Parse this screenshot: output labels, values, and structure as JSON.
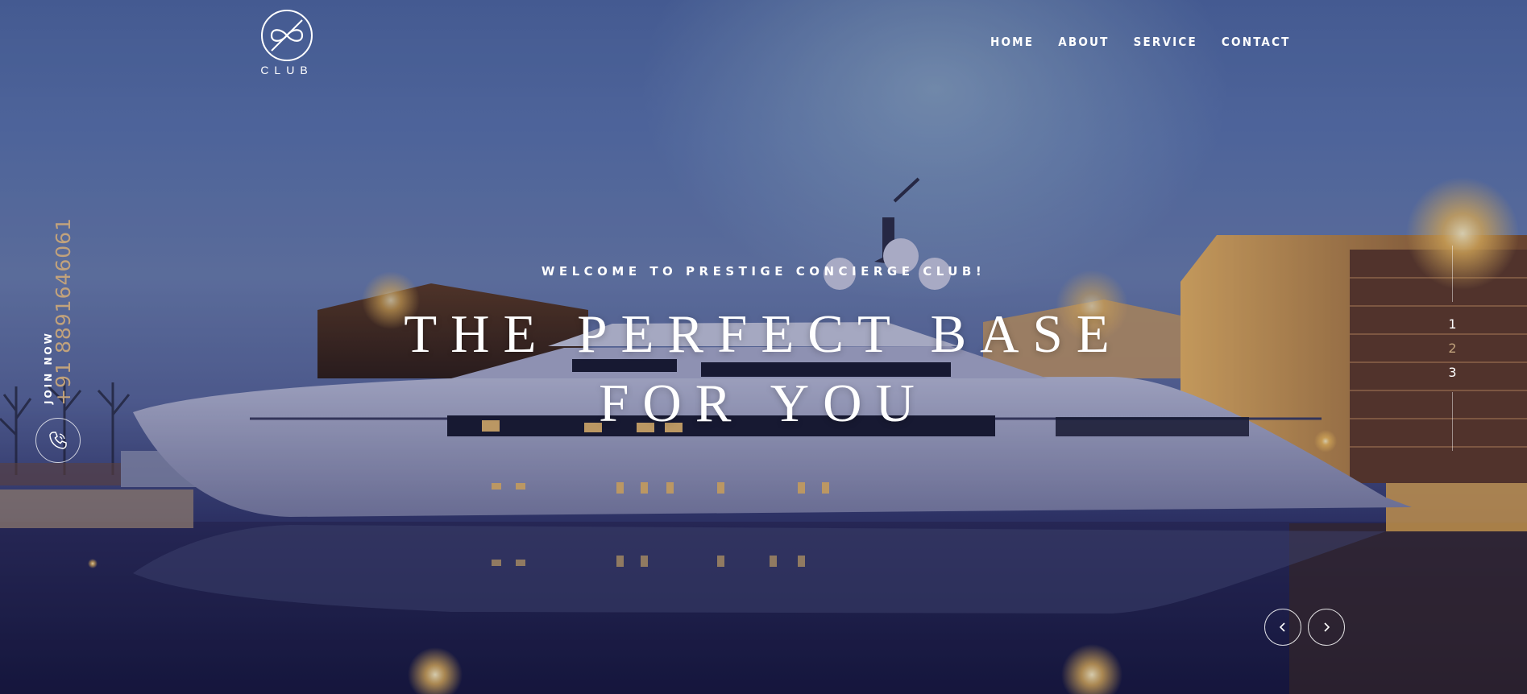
{
  "brand": {
    "logo_text": "CLUB"
  },
  "nav": {
    "items": [
      "HOME",
      "ABOUT",
      "SERVICE",
      "CONTACT"
    ]
  },
  "hero": {
    "kicker": "WELCOME TO PRESTIGE CONCIERGE CLUB!",
    "headline_line1": "THE PERFECT BASE",
    "headline_line2": "FOR YOU",
    "background": "yacht-at-dusk-image"
  },
  "contact": {
    "phone": "+91 8891646061",
    "join_label": "JOIN NOW",
    "icon": "phone-icon",
    "phone_color": "#c1a27c"
  },
  "slider": {
    "pages": [
      "1",
      "2",
      "3"
    ],
    "active_page": "2",
    "prev_icon": "chevron-left-icon",
    "next_icon": "chevron-right-icon"
  }
}
